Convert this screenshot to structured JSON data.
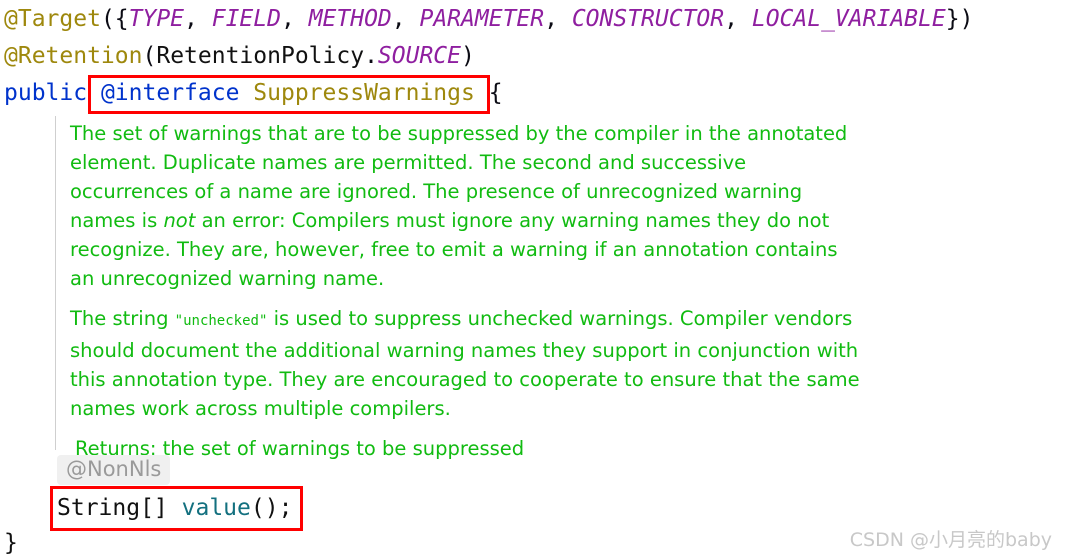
{
  "code": {
    "line1": {
      "annotation": "@Target",
      "open": "({",
      "enums": [
        "TYPE",
        "FIELD",
        "METHOD",
        "PARAMETER",
        "CONSTRUCTOR",
        "LOCAL_VARIABLE"
      ],
      "separator": ", ",
      "close": "})"
    },
    "line2": {
      "annotation": "@Retention",
      "open": "(",
      "identifier": "RetentionPolicy",
      "dot": ".",
      "enum": "SOURCE",
      "close": ")"
    },
    "line3": {
      "modifier": "public",
      "space": " ",
      "keyword": "@interface",
      "type_name": "SuppressWarnings",
      "brace": "{"
    },
    "method_line": {
      "return_type": "String[]",
      "space": " ",
      "name": "value",
      "tail": "();"
    },
    "closing_brace": "}"
  },
  "inlay_hint": {
    "label": "@NonNls"
  },
  "javadoc": {
    "paragraph1_part1": "The set of warnings that are to be suppressed by the compiler in the annotated element. Duplicate names are permitted. The second and successive occurrences of a name are ignored. The presence of unrecognized warning names is ",
    "paragraph1_italic": "not",
    "paragraph1_part2": " an error: Compilers must ignore any warning names they do not recognize. They are, however, free to emit a warning if an annotation contains an unrecognized warning name.",
    "paragraph2_part1": "The string ",
    "paragraph2_code": "\"unchecked\"",
    "paragraph2_part2": " is used to suppress unchecked warnings. Compiler vendors should document the additional warning names they support in conjunction with this annotation type. They are encouraged to cooperate to ensure that the same names work across multiple compilers.",
    "returns": "Returns: the set of warnings to be suppressed"
  },
  "watermark": {
    "text": "CSDN @小月亮的baby"
  },
  "colors": {
    "annotation": "#9e880d",
    "enum_constant": "#8f1fa0",
    "keyword": "#0033cc",
    "type_name": "#9e880d",
    "method_name": "#13707f",
    "javadoc_green": "#11bb11",
    "highlight_box": "#ff0000",
    "inlay_hint_text": "#9a9a9a",
    "inlay_hint_bg": "#f0f0f0",
    "watermark": "#c8c8c8",
    "background": "#ffffff"
  }
}
